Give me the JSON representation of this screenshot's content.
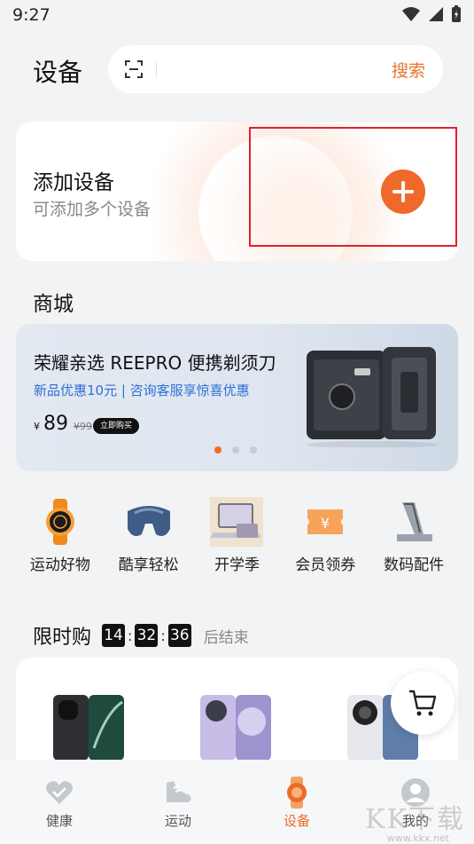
{
  "status_bar": {
    "time": "9:27"
  },
  "header": {
    "title": "设备",
    "search_button": "搜索"
  },
  "add_device": {
    "title": "添加设备",
    "subtitle": "可添加多个设备"
  },
  "mall": {
    "title": "商城",
    "banner": {
      "title": "荣耀亲选 REEPRO 便携剃须刀",
      "subtitle": "新品优惠10元 | 咨询客服享惊喜优惠",
      "currency": "¥",
      "price": "89",
      "old_price": "¥99",
      "buy_label": "立即购买",
      "carousel": {
        "pages": 3,
        "active": 1
      }
    },
    "categories": [
      {
        "label": "运动好物",
        "icon": "sports-watch-icon"
      },
      {
        "label": "酷享轻松",
        "icon": "neck-pillow-icon"
      },
      {
        "label": "开学季",
        "icon": "laptop-icon"
      },
      {
        "label": "会员领券",
        "icon": "coupon-icon"
      },
      {
        "label": "数码配件",
        "icon": "phone-stand-icon"
      }
    ]
  },
  "flash_sale": {
    "title": "限时购",
    "hours": "14",
    "minutes": "32",
    "seconds": "36",
    "ends_label": "后结束"
  },
  "tabs": [
    {
      "label": "健康",
      "icon": "heart-icon",
      "active": false
    },
    {
      "label": "运动",
      "icon": "running-shoe-icon",
      "active": false
    },
    {
      "label": "设备",
      "icon": "watch-icon",
      "active": true
    },
    {
      "label": "我的",
      "icon": "profile-icon",
      "active": false
    }
  ],
  "watermark": {
    "text": "KK下载",
    "url": "www.kkx.net"
  },
  "colors": {
    "accent": "#ef6a2a",
    "highlight_border": "#e0202a",
    "link_blue": "#2f6fd6"
  }
}
